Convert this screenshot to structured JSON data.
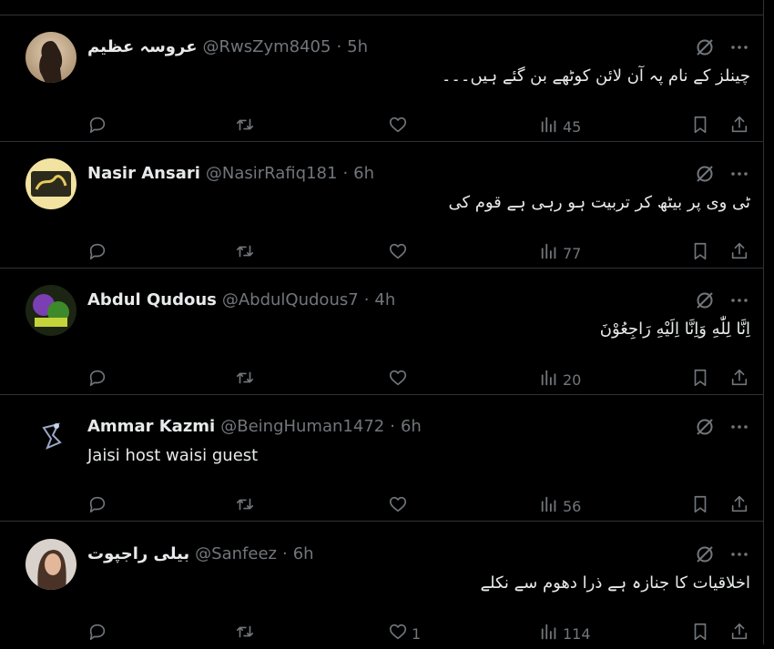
{
  "tweets": [
    {
      "name": "عروسہ عظیم",
      "handle": "@RwsZym8405",
      "time": "5h",
      "text": "چینلز کے نام پہ آن لائن کوٹھے بن گئے ہیں۔۔۔",
      "rtl": true,
      "likes": "",
      "views": "45"
    },
    {
      "name": "Nasir Ansari",
      "handle": "@NasirRafiq181",
      "time": "6h",
      "text": "ٹی وی پر بیٹھ کر تربیت ہو رہی ہے قوم کی",
      "rtl": true,
      "likes": "",
      "views": "77"
    },
    {
      "name": "Abdul Qudous",
      "handle": "@AbdulQudous7",
      "time": "4h",
      "text": "اِنَّا لِلّٰهِ وَاِنَّا اِلَيْهِ رَاجِعُوْنَ",
      "rtl": true,
      "likes": "",
      "views": "20"
    },
    {
      "name": "Ammar Kazmi",
      "handle": "@BeingHuman1472",
      "time": "6h",
      "text": "Jaisi host waisi guest",
      "rtl": false,
      "likes": "",
      "views": "56"
    },
    {
      "name": "بیلی راجپوت",
      "handle": "@Sanfeez",
      "time": "6h",
      "text": "اخلاقیات کا جنازہ ہے ذرا دھوم سے نکلے",
      "rtl": true,
      "likes": "1",
      "views": "114"
    }
  ],
  "separator": "·",
  "colors": {
    "background": "#000000",
    "text": "#e7e9ea",
    "muted": "#71767b",
    "border": "#2f3336"
  },
  "icons": [
    "grok-icon",
    "more-icon",
    "reply-icon",
    "retweet-icon",
    "like-icon",
    "views-icon",
    "bookmark-icon",
    "share-icon"
  ]
}
